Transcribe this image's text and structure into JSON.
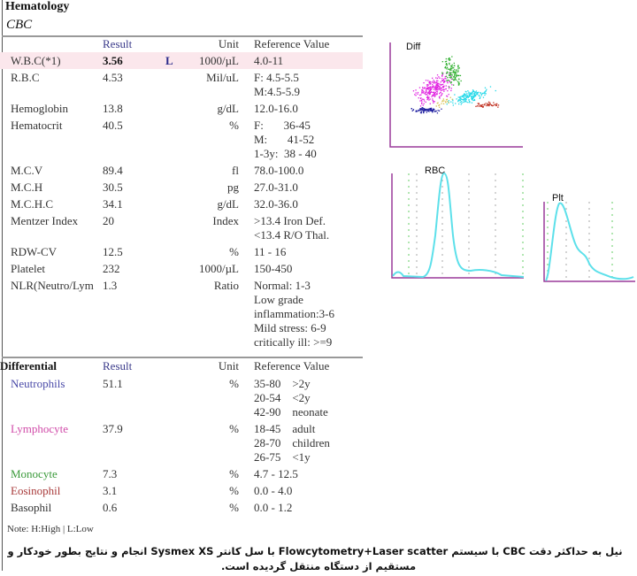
{
  "section": "Hematology",
  "subsection": "CBC",
  "headers": {
    "result": "Result",
    "unit": "Unit",
    "reference": "Reference Value"
  },
  "cbc_rows": [
    {
      "name": "W.B.C(*1)",
      "result": "3.56",
      "flag": "L",
      "unit": "1000/µL",
      "ref": [
        "4.0-11"
      ],
      "highlight": true
    },
    {
      "name": "R.B.C",
      "result": "4.53",
      "flag": "",
      "unit": "Mil/uL",
      "ref": [
        "F: 4.5-5.5",
        "M:4.5-5.9"
      ]
    },
    {
      "name": "Hemoglobin",
      "result": "13.8",
      "flag": "",
      "unit": "g/dL",
      "ref": [
        "12.0-16.0"
      ]
    },
    {
      "name": "Hematocrit",
      "result": "40.5",
      "flag": "",
      "unit": "%",
      "ref": [
        "F:       36-45",
        "M:       41-52",
        "1-3y:  38 - 40"
      ]
    },
    {
      "name": "M.C.V",
      "result": "89.4",
      "flag": "",
      "unit": "fl",
      "ref": [
        "78.0-100.0"
      ]
    },
    {
      "name": "M.C.H",
      "result": "30.5",
      "flag": "",
      "unit": "pg",
      "ref": [
        "27.0-31.0"
      ]
    },
    {
      "name": "M.C.H.C",
      "result": "34.1",
      "flag": "",
      "unit": "g/dL",
      "ref": [
        "32.0-36.0"
      ]
    },
    {
      "name": "Mentzer Index",
      "result": "20",
      "flag": "",
      "unit": "Index",
      "ref": [
        ">13.4 Iron Def.",
        "<13.4 R/O Thal."
      ]
    },
    {
      "name": "RDW-CV",
      "result": "12.5",
      "flag": "",
      "unit": "%",
      "ref": [
        "11 - 16"
      ]
    },
    {
      "name": "Platelet",
      "result": "232",
      "flag": "",
      "unit": "1000/µL",
      "ref": [
        "150-450"
      ]
    },
    {
      "name": "NLR(Neutro/Lym",
      "result": "1.3",
      "flag": "",
      "unit": "Ratio",
      "ref": [
        "Normal: 1-3",
        "Low grade",
        "inflammation:3-6",
        "Mild stress: 6-9",
        "critically ill: >=9"
      ]
    }
  ],
  "differential": {
    "title": "Differential",
    "rows": [
      {
        "name": "Neutrophils",
        "color": "#4a4aa8",
        "result": "51.1",
        "unit": "%",
        "ref": [
          "35-80    >2y",
          "20-54    <2y",
          "42-90    neonate"
        ]
      },
      {
        "name": "Lymphocyte",
        "color": "#d04aa8",
        "result": "37.9",
        "unit": "%",
        "ref": [
          "18-45    adult",
          "28-70    children",
          "26-75    <1y"
        ]
      },
      {
        "name": "Monocyte",
        "color": "#3a9a3a",
        "result": "7.3",
        "unit": "%",
        "ref": [
          "4.7 - 12.5"
        ]
      },
      {
        "name": "Eosinophil",
        "color": "#a83a3a",
        "result": "3.1",
        "unit": "%",
        "ref": [
          "0.0 - 4.0"
        ]
      },
      {
        "name": "Basophil",
        "color": "#333333",
        "result": "0.6",
        "unit": "%",
        "ref": [
          "0.0 - 1.2"
        ]
      }
    ]
  },
  "charts": {
    "diff": "Diff",
    "rbc": "RBC",
    "plt": "Plt",
    "axis_color": "#9a3a9a",
    "curve_color": "#5de0ea"
  },
  "note": "Note:  H:High  |  L:Low",
  "footer": [
    "نیل به حداکثر دقت CBC با سیستم Flowcytometry+Laser  scatter با سل کانتر Sysmex XS  انجام و نتایج بطور خودکار و",
    "مستقیم از دستگاه منتقل گردیده است."
  ]
}
